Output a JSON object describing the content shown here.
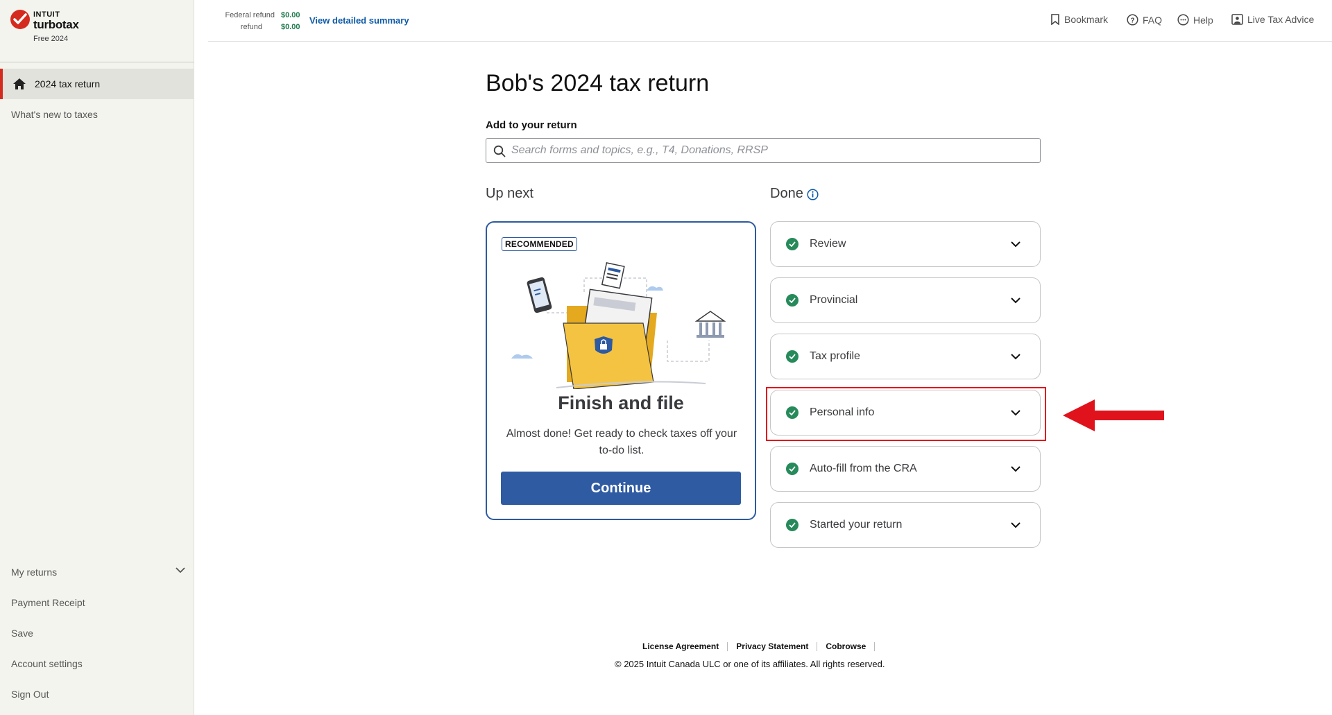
{
  "brand": {
    "company": "INTUIT",
    "product": "turbotax",
    "edition": "Free 2024"
  },
  "sidebar": {
    "active_item": "2024 tax return",
    "items": [
      "What's new to taxes"
    ],
    "bottom_items": [
      "My returns",
      "Payment Receipt",
      "Save",
      "Account settings",
      "Sign Out"
    ]
  },
  "header": {
    "federal_refund_label": "Federal refund",
    "refund_label": "refund",
    "federal_refund_value": "$0.00",
    "provincial_refund_value": "$0.00",
    "detail_link": "View detailed summary",
    "nav": {
      "bookmark": "Bookmark",
      "faq": "FAQ",
      "help": "Help",
      "live_advice": "Live Tax Advice"
    }
  },
  "main": {
    "title": "Bob's 2024 tax return",
    "add_label": "Add to your return",
    "search_placeholder": "Search forms and topics, e.g., T4, Donations, RRSP",
    "up_next_heading": "Up next",
    "done_heading": "Done",
    "recommended": {
      "badge": "RECOMMENDED",
      "title": "Finish and file",
      "description": "Almost done! Get ready to check taxes off your to-do list.",
      "button": "Continue"
    },
    "done_items": [
      "Review",
      "Provincial",
      "Tax profile",
      "Personal info",
      "Auto-fill from the CRA",
      "Started your return"
    ]
  },
  "footer": {
    "links": [
      "License Agreement",
      "Privacy Statement",
      "Cobrowse"
    ],
    "copyright": "© 2025 Intuit Canada ULC or one of its affiliates. All rights reserved."
  },
  "colors": {
    "brand_red": "#d52b1e",
    "primary_blue": "#2f5ba3",
    "success_green": "#268a5a",
    "annotation_red": "#e0121b"
  }
}
